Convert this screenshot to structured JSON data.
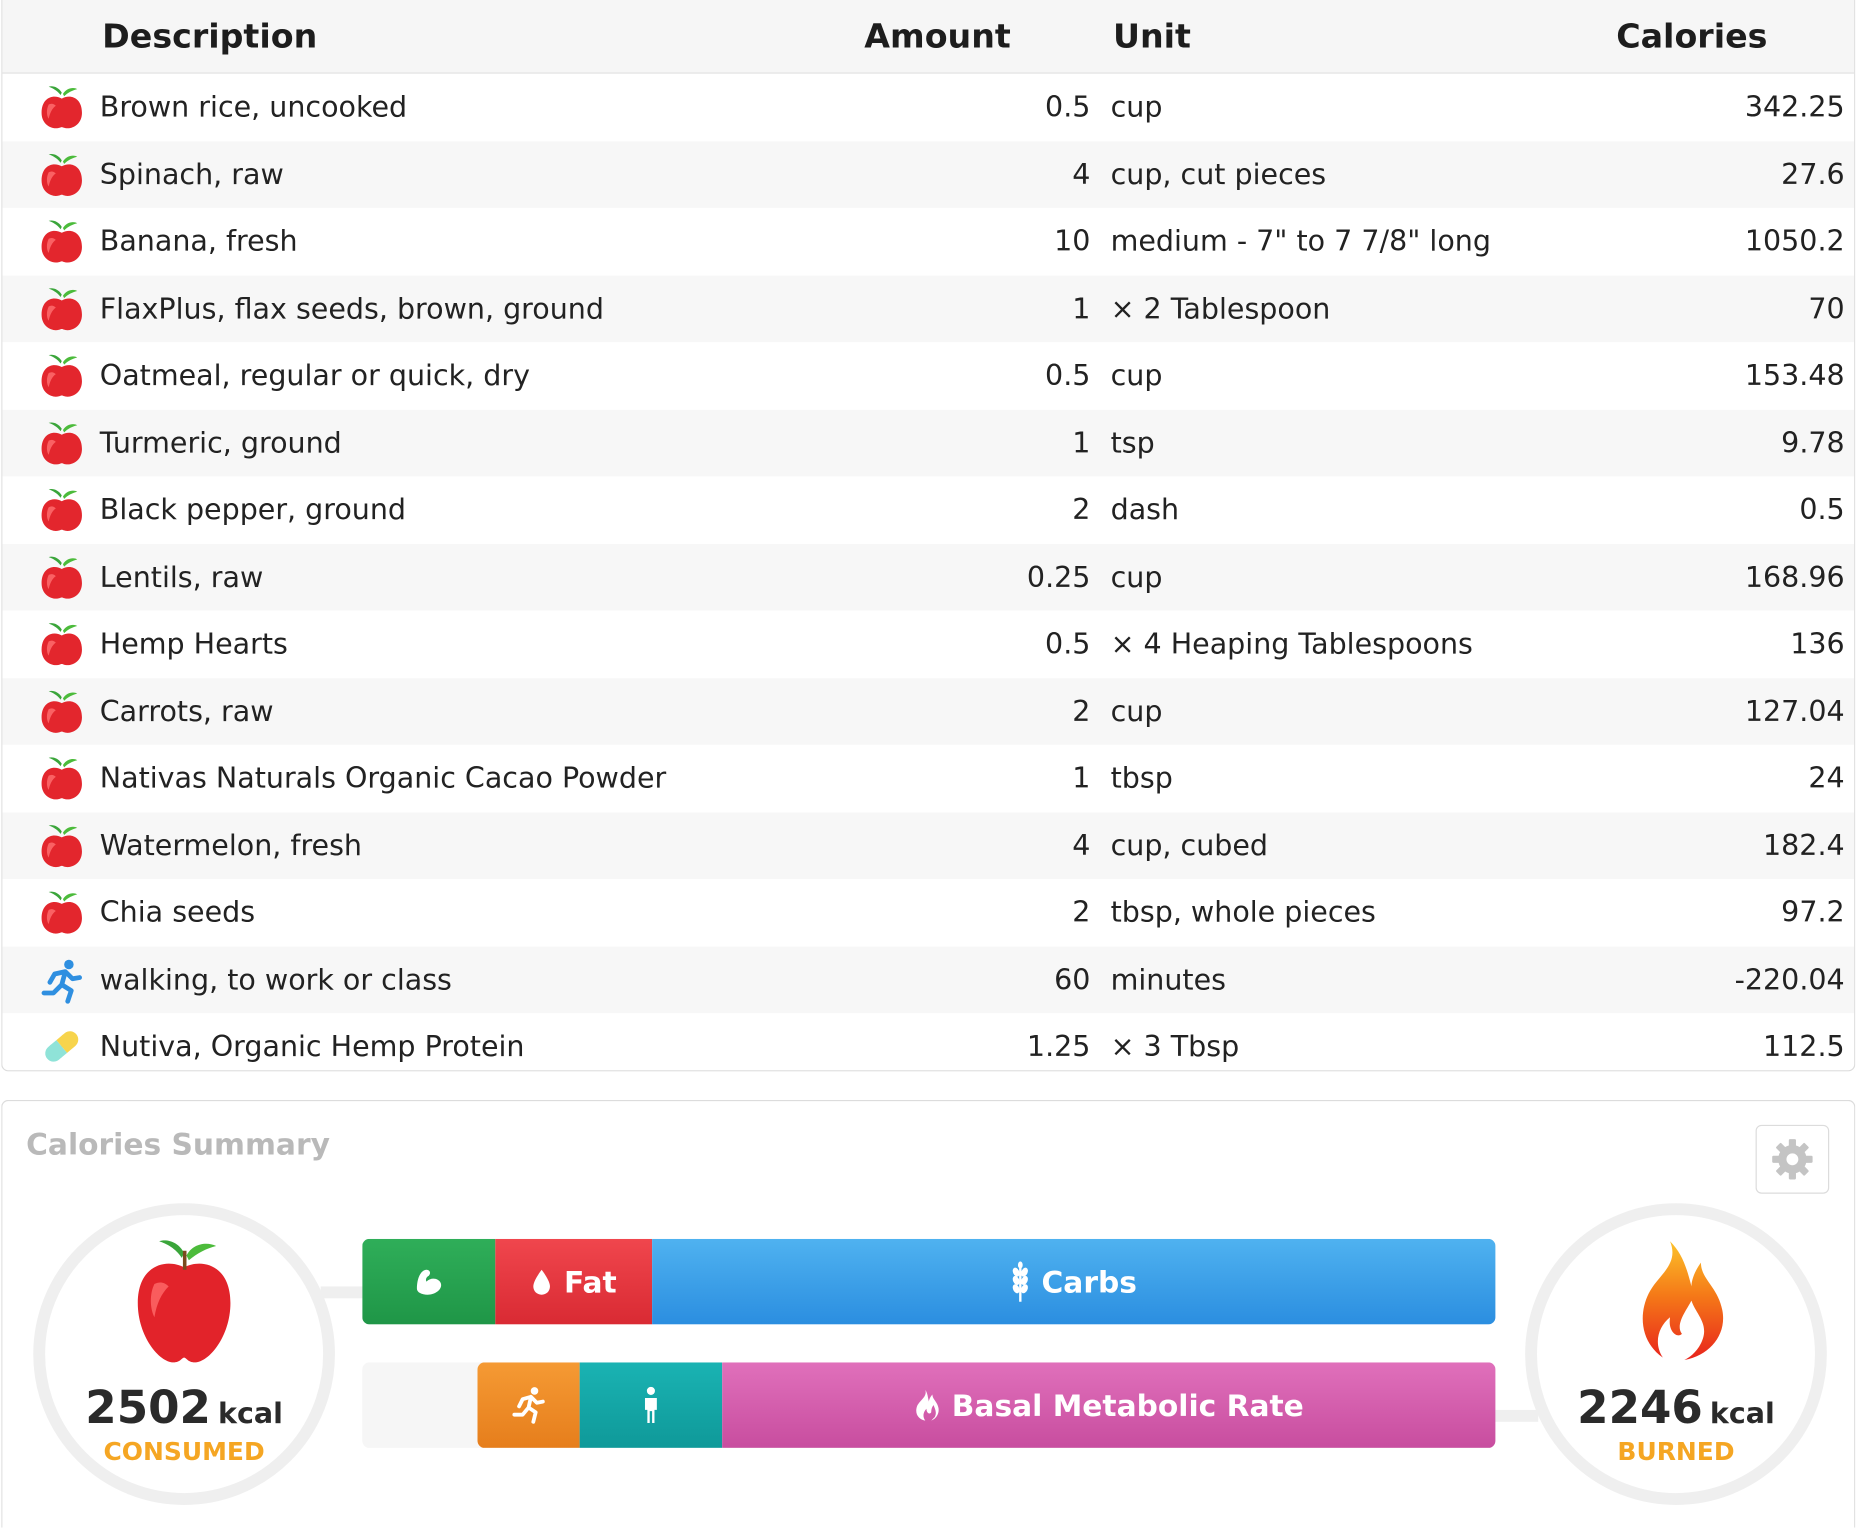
{
  "table": {
    "headers": {
      "description": "Description",
      "amount": "Amount",
      "unit": "Unit",
      "calories": "Calories"
    },
    "rows": [
      {
        "type": "food",
        "icon": "apple-icon",
        "description": "Brown rice, uncooked",
        "amount": "0.5",
        "unit": "cup",
        "calories": "342.25"
      },
      {
        "type": "food",
        "icon": "apple-icon",
        "description": "Spinach, raw",
        "amount": "4",
        "unit": "cup, cut pieces",
        "calories": "27.6"
      },
      {
        "type": "food",
        "icon": "apple-icon",
        "description": "Banana, fresh",
        "amount": "10",
        "unit": "medium - 7\" to 7 7/8\" long",
        "calories": "1050.2"
      },
      {
        "type": "food",
        "icon": "apple-icon",
        "description": "FlaxPlus, flax seeds, brown, ground",
        "amount": "1",
        "unit": "× 2 Tablespoon",
        "calories": "70"
      },
      {
        "type": "food",
        "icon": "apple-icon",
        "description": "Oatmeal, regular or quick, dry",
        "amount": "0.5",
        "unit": "cup",
        "calories": "153.48"
      },
      {
        "type": "food",
        "icon": "apple-icon",
        "description": "Turmeric, ground",
        "amount": "1",
        "unit": "tsp",
        "calories": "9.78"
      },
      {
        "type": "food",
        "icon": "apple-icon",
        "description": "Black pepper, ground",
        "amount": "2",
        "unit": "dash",
        "calories": "0.5"
      },
      {
        "type": "food",
        "icon": "apple-icon",
        "description": "Lentils, raw",
        "amount": "0.25",
        "unit": "cup",
        "calories": "168.96"
      },
      {
        "type": "food",
        "icon": "apple-icon",
        "description": "Hemp Hearts",
        "amount": "0.5",
        "unit": "× 4 Heaping Tablespoons",
        "calories": "136"
      },
      {
        "type": "food",
        "icon": "apple-icon",
        "description": "Carrots, raw",
        "amount": "2",
        "unit": "cup",
        "calories": "127.04"
      },
      {
        "type": "food",
        "icon": "apple-icon",
        "description": "Nativas Naturals Organic Cacao Powder",
        "amount": "1",
        "unit": "tbsp",
        "calories": "24"
      },
      {
        "type": "food",
        "icon": "apple-icon",
        "description": "Watermelon, fresh",
        "amount": "4",
        "unit": "cup, cubed",
        "calories": "182.4"
      },
      {
        "type": "food",
        "icon": "apple-icon",
        "description": "Chia seeds",
        "amount": "2",
        "unit": "tbsp, whole pieces",
        "calories": "97.2"
      },
      {
        "type": "exercise",
        "icon": "running-person-icon",
        "description": "walking, to work or class",
        "amount": "60",
        "unit": "minutes",
        "calories": "-220.04"
      },
      {
        "type": "supplement",
        "icon": "pill-capsule-icon",
        "description": "Nutiva, Organic Hemp Protein",
        "amount": "1.25",
        "unit": "× 3 Tbsp",
        "calories": "112.5"
      }
    ]
  },
  "summary": {
    "title": "Calories Summary",
    "settings_icon": "gear-icon",
    "consumed": {
      "value": "2502",
      "unit": "kcal",
      "label": "CONSUMED",
      "icon": "apple-icon"
    },
    "burned": {
      "value": "2246",
      "unit": "kcal",
      "label": "BURNED",
      "icon": "flame-icon"
    },
    "consumed_bar": [
      {
        "key": "protein",
        "label": "",
        "icon": "flexed-arm-icon",
        "color": "#27a150"
      },
      {
        "key": "fat",
        "label": "Fat",
        "icon": "drop-icon",
        "color": "#e5343c"
      },
      {
        "key": "carbs",
        "label": "Carbs",
        "icon": "wheat-icon",
        "color": "#3a9fe8"
      }
    ],
    "burned_bar": [
      {
        "key": "exercise",
        "label": "",
        "icon": "running-person-icon",
        "color": "#ee8c28"
      },
      {
        "key": "tef",
        "label": "",
        "icon": "standing-person-icon",
        "color": "#14a6a6"
      },
      {
        "key": "bmr",
        "label": "Basal Metabolic Rate",
        "icon": "flame-icon",
        "color": "#d45fad"
      }
    ]
  }
}
